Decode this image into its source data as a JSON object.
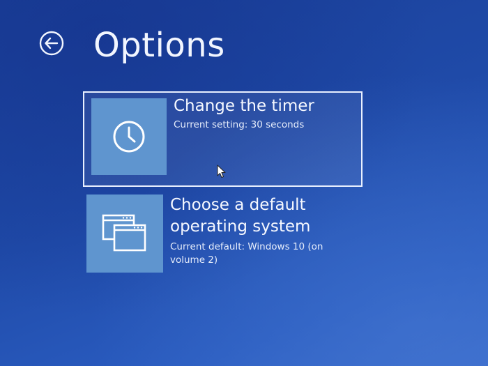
{
  "header": {
    "title": "Options",
    "back_icon": "back-arrow-circle-icon"
  },
  "options": [
    {
      "title": "Change the timer",
      "subtitle": "Current setting: 30 seconds",
      "icon": "clock-icon",
      "selected": true
    },
    {
      "title": "Choose a default operating system",
      "subtitle": "Current default: Windows 10 (on volume 2)",
      "icon": "windows-stack-icon",
      "selected": false
    }
  ],
  "colors": {
    "background": "#1f4aa8",
    "tile": "#5f95cf",
    "text": "#ffffff",
    "selection_border": "#e9f0ff"
  },
  "pointer": "mouse-pointer-icon"
}
